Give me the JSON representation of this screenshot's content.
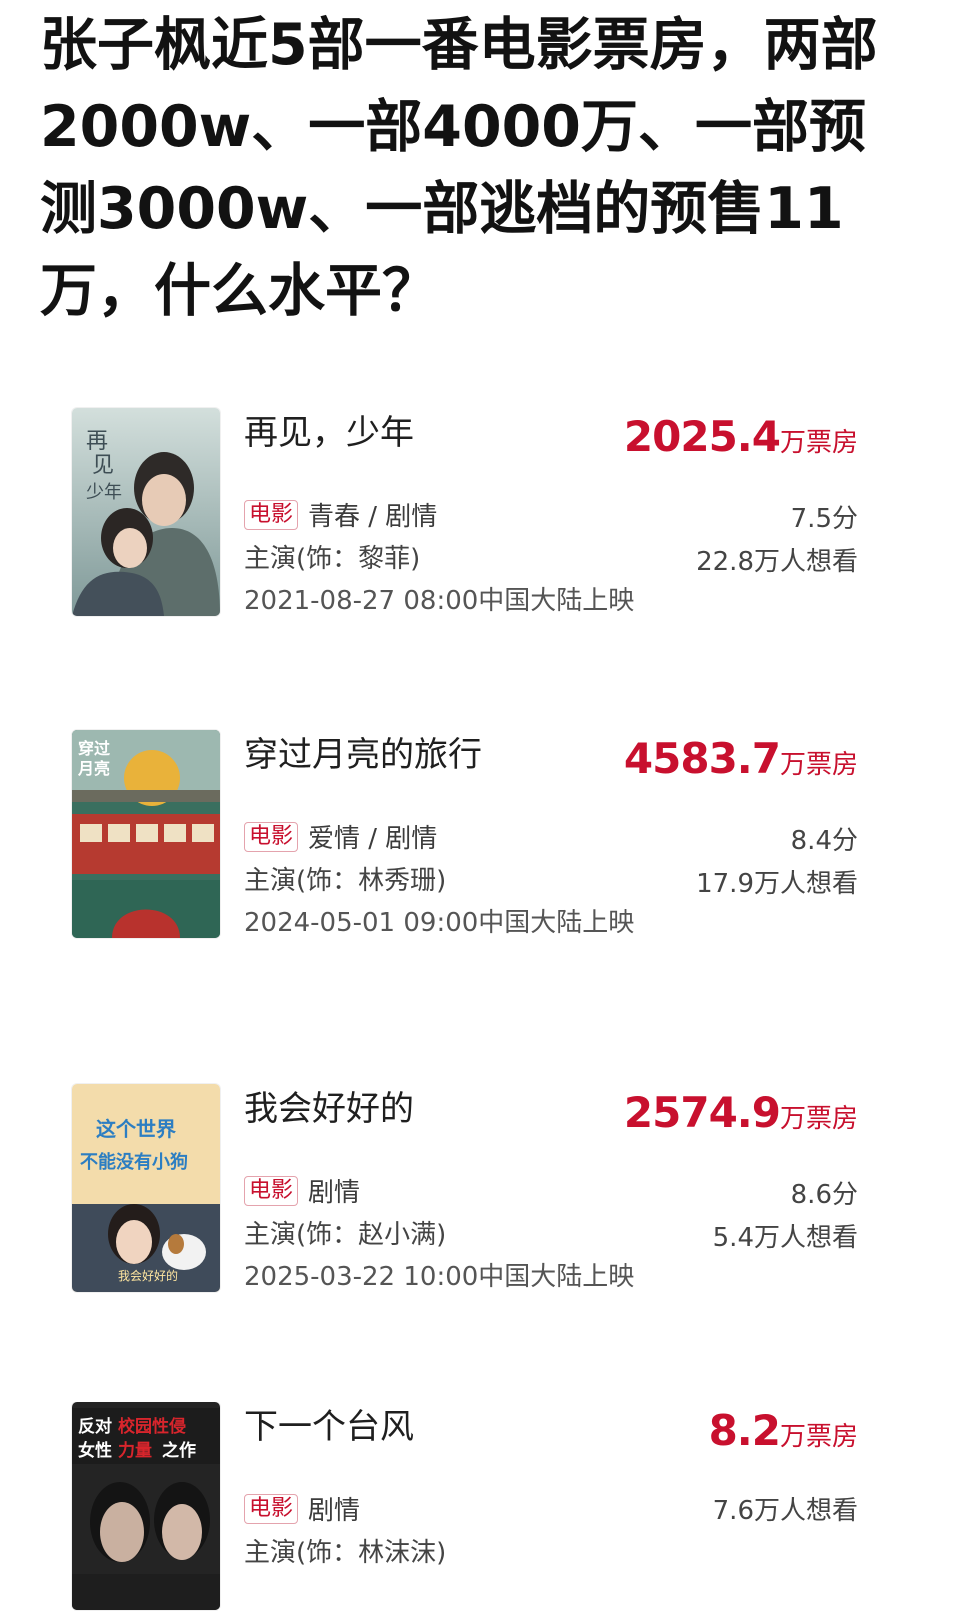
{
  "headline": "张子枫近5部一番电影票房，两部2000w、一部4000万、一部预测3000w、一部逃档的预售11万，什么水平？",
  "movies": [
    {
      "title": "再见，少年",
      "box_office_value": "2025.4",
      "box_office_unit": "万票房",
      "tag": "电影",
      "genre": "青春 / 剧情",
      "cast": "主演(饰：黎菲)",
      "release": "2021-08-27 08:00中国大陆上映",
      "score": "7.5分",
      "want": "22.8万人想看",
      "poster_text": "再见少年",
      "poster_colors": [
        "#c9d6d3",
        "#8fa7a6"
      ]
    },
    {
      "title": "穿过月亮的旅行",
      "box_office_value": "4583.7",
      "box_office_unit": "万票房",
      "tag": "电影",
      "genre": "爱情 / 剧情",
      "cast": "主演(饰：林秀珊)",
      "release": "2024-05-01 09:00中国大陆上映",
      "score": "8.4分",
      "want": "17.9万人想看",
      "poster_text": "穿过月亮的旅行",
      "poster_colors": [
        "#2f6b5a",
        "#b8322d"
      ]
    },
    {
      "title": "我会好好的",
      "box_office_value": "2574.9",
      "box_office_unit": "万票房",
      "tag": "电影",
      "genre": "剧情",
      "cast": "主演(饰：赵小满)",
      "release": "2025-03-22 10:00中国大陆上映",
      "score": "8.6分",
      "want": "5.4万人想看",
      "poster_text": "这个世界不能没有小狗",
      "poster_colors": [
        "#f4d9a6",
        "#3c4a5a"
      ]
    },
    {
      "title": "下一个台风",
      "box_office_value": "8.2",
      "box_office_unit": "万票房",
      "tag": "电影",
      "genre": "剧情",
      "cast": "主演(饰：林沫沫)",
      "release": "",
      "score": "",
      "want": "7.6万人想看",
      "poster_text": "反对校园性侵 女性力量之作",
      "poster_colors": [
        "#2a2a2a",
        "#b01e23"
      ]
    }
  ]
}
